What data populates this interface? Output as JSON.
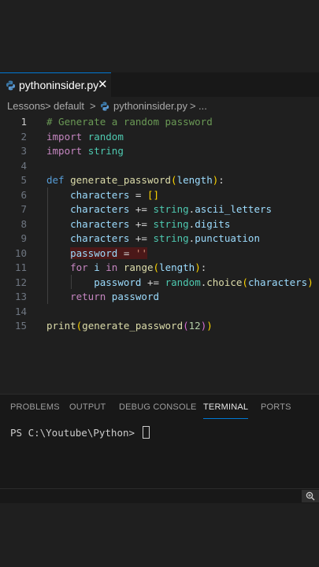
{
  "tab": {
    "filename": "pythoninsider.py",
    "close": "✕"
  },
  "breadcrumb": {
    "seg1": "Lessons",
    "seg2": "default",
    "seg3": "pythoninsider.py",
    "seg4": "...",
    "sep": ">"
  },
  "line_numbers": [
    "1",
    "2",
    "3",
    "4",
    "5",
    "6",
    "7",
    "8",
    "9",
    "10",
    "11",
    "12",
    "13",
    "14",
    "15"
  ],
  "code": {
    "l1": "# Generate a random password",
    "import": "import",
    "random": "random",
    "string": "string",
    "def": "def",
    "func": "generate_password",
    "length": "length",
    "characters": "characters",
    "eq": "=",
    "pluseq": "+=",
    "emptylist": "[]",
    "ascii_letters": "ascii_letters",
    "digits": "digits",
    "punctuation": "punctuation",
    "password": "password",
    "emptystr": "''",
    "for": "for",
    "i": "i",
    "in": "in",
    "range": "range",
    "choice": "choice",
    "return": "return",
    "print": "print",
    "twelve": "12"
  },
  "panel": {
    "tabs": [
      "PROBLEMS",
      "OUTPUT",
      "DEBUG CONSOLE",
      "TERMINAL",
      "PORTS"
    ],
    "active_tab": "TERMINAL",
    "prompt": "PS C:\\Youtube\\Python>"
  },
  "status": {
    "zoom_icon": "zoom-in-icon"
  },
  "colors": {
    "accent": "#0078d4",
    "editor_bg": "#1f1f1f",
    "error_highlight": "#4b1818"
  }
}
